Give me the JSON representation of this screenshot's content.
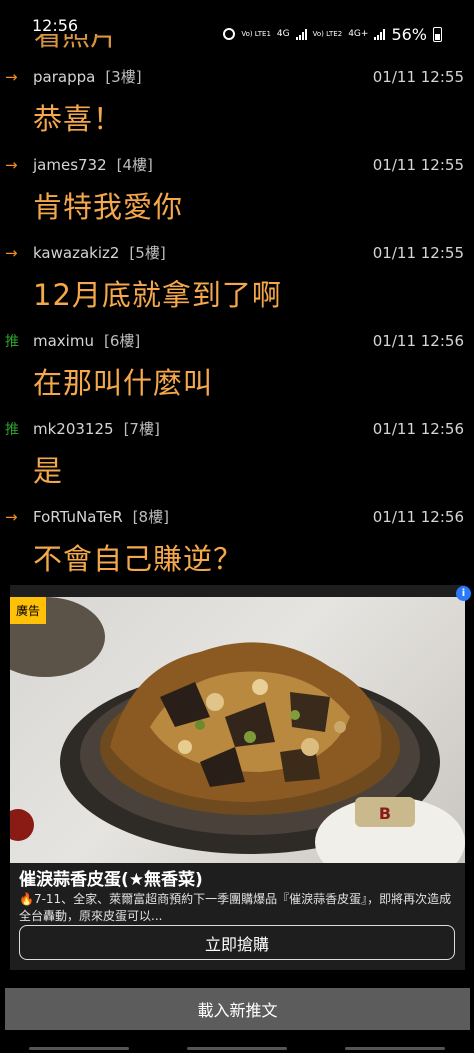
{
  "status_bar": {
    "time": "12:56",
    "sim1": "Vo) LTE1",
    "network1": "4G",
    "sim2": "Vo) LTE2",
    "network2": "4G+",
    "battery": "56%"
  },
  "clipped_top_text": "看照片",
  "comments": [
    {
      "tag": "→",
      "tag_type": "arrow",
      "user": "parappa",
      "floor": "[3樓]",
      "time": "01/11 12:55",
      "text": "恭喜！"
    },
    {
      "tag": "→",
      "tag_type": "arrow",
      "user": "james732",
      "floor": "[4樓]",
      "time": "01/11 12:55",
      "text": "肯特我愛你"
    },
    {
      "tag": "→",
      "tag_type": "arrow",
      "user": "kawazakiz2",
      "floor": "[5樓]",
      "time": "01/11 12:55",
      "text": "12月底就拿到了啊"
    },
    {
      "tag": "推",
      "tag_type": "push",
      "user": "maximu",
      "floor": "[6樓]",
      "time": "01/11 12:56",
      "text": "在那叫什麼叫"
    },
    {
      "tag": "推",
      "tag_type": "push",
      "user": "mk203125",
      "floor": "[7樓]",
      "time": "01/11 12:56",
      "text": "是"
    },
    {
      "tag": "→",
      "tag_type": "arrow",
      "user": "FoRTuNaTeR",
      "floor": "[8樓]",
      "time": "01/11 12:56",
      "text": "不會自己賺逆？"
    }
  ],
  "ad": {
    "label": "廣告",
    "info_icon": "i",
    "jar_label": "B",
    "title": "催淚蒜香皮蛋(★無香菜)",
    "description": "🔥7-11、全家、萊爾富超商預約下一季團購爆品『催淚蒜香皮蛋』，即將再次造成全台轟動，原來皮蛋可以...",
    "cta": "立即搶購"
  },
  "load_more": "載入新推文",
  "colors": {
    "comment_text": "#f4a84b",
    "arrow_tag": "#f28c1e",
    "push_tag": "#2ca02c",
    "ad_label_bg": "#ffc107"
  }
}
